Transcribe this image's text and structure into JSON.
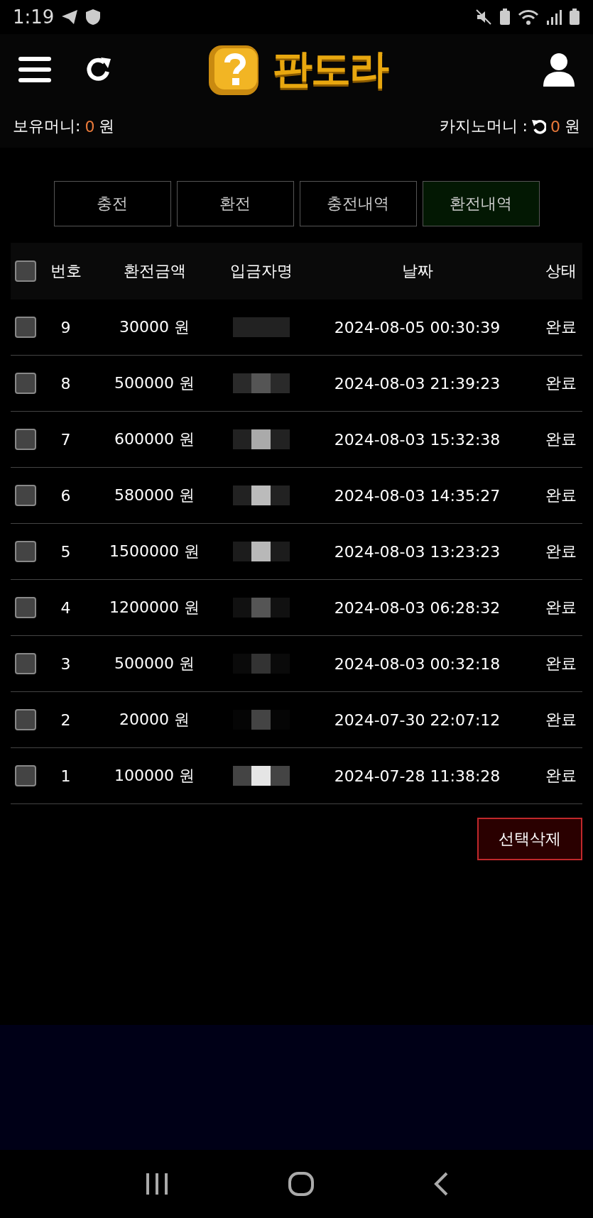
{
  "status_bar": {
    "time": "1:19"
  },
  "header": {
    "logo_text": "판도라"
  },
  "balances": {
    "holding_label": "보유머니:",
    "holding_value": "0",
    "holding_unit": "원",
    "casino_label": "카지노머니 :",
    "casino_value": "0",
    "casino_unit": "원"
  },
  "tabs": [
    {
      "label": "충전",
      "selected": false
    },
    {
      "label": "환전",
      "selected": false
    },
    {
      "label": "충전내역",
      "selected": false
    },
    {
      "label": "환전내역",
      "selected": true
    }
  ],
  "table": {
    "select_all_checked": false,
    "columns": [
      "번호",
      "환전금액",
      "입금자명",
      "날짜",
      "상태"
    ],
    "rows": [
      {
        "checked": false,
        "number": "9",
        "amount": "30000 원",
        "date": "2024-08-05 00:30:39",
        "status": "완료"
      },
      {
        "checked": false,
        "number": "8",
        "amount": "500000 원",
        "date": "2024-08-03 21:39:23",
        "status": "완료"
      },
      {
        "checked": false,
        "number": "7",
        "amount": "600000 원",
        "date": "2024-08-03 15:32:38",
        "status": "완료"
      },
      {
        "checked": false,
        "number": "6",
        "amount": "580000 원",
        "date": "2024-08-03 14:35:27",
        "status": "완료"
      },
      {
        "checked": false,
        "number": "5",
        "amount": "1500000 원",
        "date": "2024-08-03 13:23:23",
        "status": "완료"
      },
      {
        "checked": false,
        "number": "4",
        "amount": "1200000 원",
        "date": "2024-08-03 06:28:32",
        "status": "완료"
      },
      {
        "checked": false,
        "number": "3",
        "amount": "500000 원",
        "date": "2024-08-03 00:32:18",
        "status": "완료"
      },
      {
        "checked": false,
        "number": "2",
        "amount": "20000 원",
        "date": "2024-07-30 22:07:12",
        "status": "완료"
      },
      {
        "checked": false,
        "number": "1",
        "amount": "100000 원",
        "date": "2024-07-28 11:38:28",
        "status": "완료"
      }
    ]
  },
  "delete_button": "선택삭제"
}
